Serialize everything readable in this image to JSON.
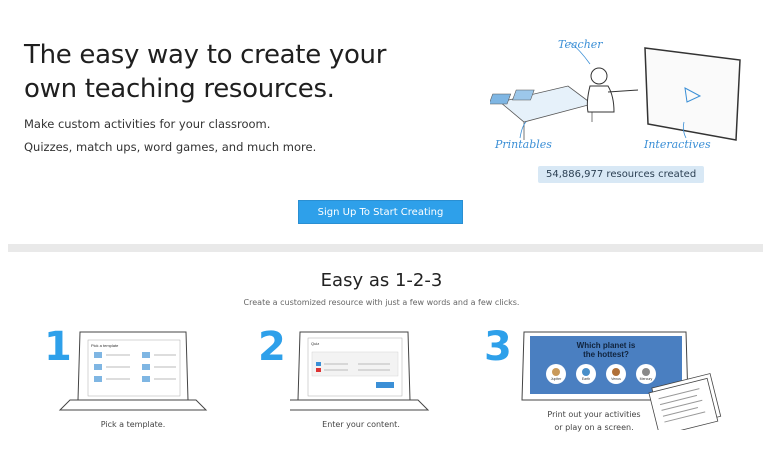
{
  "hero": {
    "title_line1": "The easy way to create your",
    "title_line2": "own teaching resources.",
    "subtitle1": "Make custom activities for your classroom.",
    "subtitle2": "Quizzes, match ups, word games, and much more."
  },
  "illustration": {
    "teacher_label": "Teacher",
    "printables_label": "Printables",
    "interactives_label": "Interactives"
  },
  "stats": {
    "resources_created": "54,886,977 resources created"
  },
  "cta": {
    "label": "Sign Up To Start Creating"
  },
  "steps_section": {
    "title": "Easy as 1-2-3",
    "subtitle": "Create a customized resource with just a few words and a few clicks.",
    "steps": [
      {
        "number": "1",
        "caption_line1": "Pick a template.",
        "screen_title": "Pick a template"
      },
      {
        "number": "2",
        "caption_line1": "Enter your content.",
        "screen_title": "Quiz"
      },
      {
        "number": "3",
        "caption_line1": "Print out your activities",
        "caption_line2": "or play on a screen.",
        "screen_question_line1": "Which planet is",
        "screen_question_line2": "the hottest?",
        "answers": [
          "Jupiter",
          "Earth",
          "Venus",
          "Mercury"
        ]
      }
    ]
  },
  "colors": {
    "accent": "#2ea0ea",
    "badge_bg": "#d8e8f5",
    "screen_blue": "#4a7fc1"
  }
}
